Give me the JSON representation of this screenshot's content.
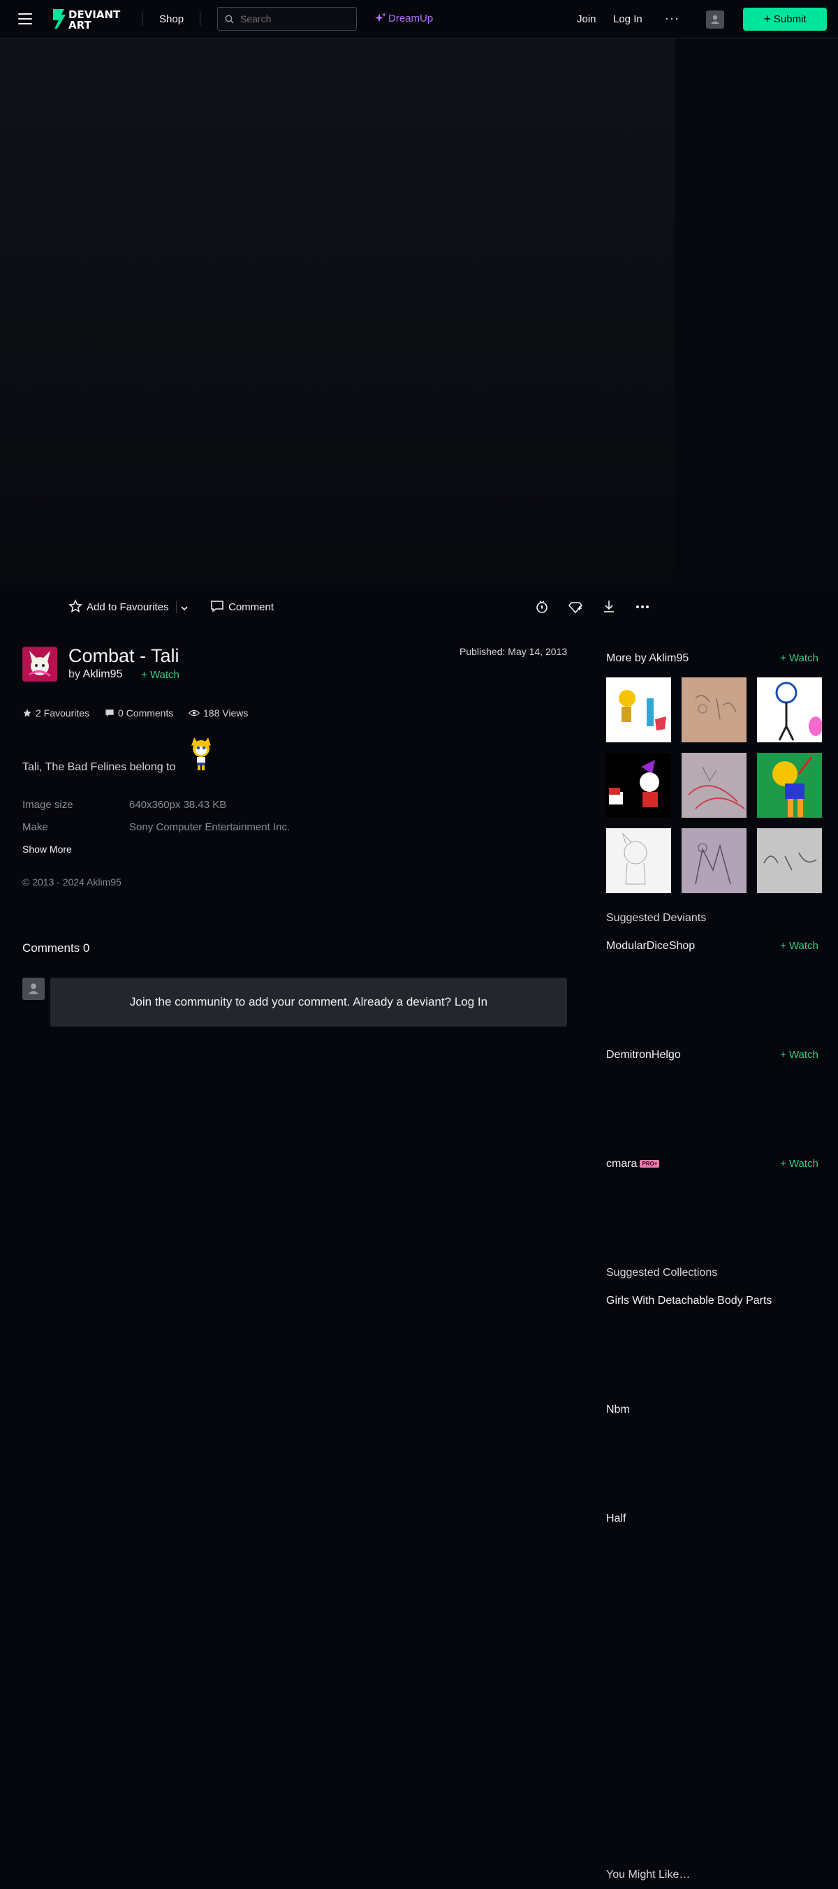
{
  "header": {
    "menu_icon": "hamburger-icon",
    "logo_text_1": "DEVIANT",
    "logo_text_2": "ART",
    "shop": "Shop",
    "search_placeholder": "Search",
    "dreamup": "DreamUp",
    "join": "Join",
    "login": "Log In",
    "more": "···",
    "submit": "Submit",
    "accent": "#00e59b",
    "dreamup_color": "#b46ef8"
  },
  "actions": {
    "favourite": "Add to Favourites",
    "comment": "Comment"
  },
  "deviation": {
    "title": "Combat - Tali",
    "by": "by",
    "author": "Aklim95",
    "watch": "Watch",
    "published_label": "Published:",
    "published_date": "May 14, 2013",
    "favourites": "2 Favourites",
    "comments": "0 Comments",
    "views": "188 Views",
    "description": "Tali, The Bad Felines belong to",
    "image_size_label": "Image size",
    "image_size_value": "640x360px 38.43 KB",
    "make_label": "Make",
    "make_value": "Sony Computer Entertainment Inc.",
    "show_more": "Show More",
    "copyright": "© 2013 - 2024 Aklim95"
  },
  "comments_section": {
    "heading": "Comments 0",
    "join_prompt": "Join the community to add your comment. Already a deviant? Log In"
  },
  "sidebar": {
    "more_by": "More by Aklim95",
    "more_by_watch": "Watch",
    "suggested_deviants_heading": "Suggested Deviants",
    "deviants": [
      {
        "name": "ModularDiceShop",
        "watch": "Watch"
      },
      {
        "name": "DemitronHelgo",
        "watch": "Watch"
      },
      {
        "name": "cmara",
        "badge": "PRO+",
        "watch": "Watch"
      }
    ],
    "suggested_collections_heading": "Suggested Collections",
    "collections": [
      "Girls With Detachable Body Parts",
      "Nbm",
      "Half"
    ],
    "you_might_like": "You Might Like…"
  }
}
